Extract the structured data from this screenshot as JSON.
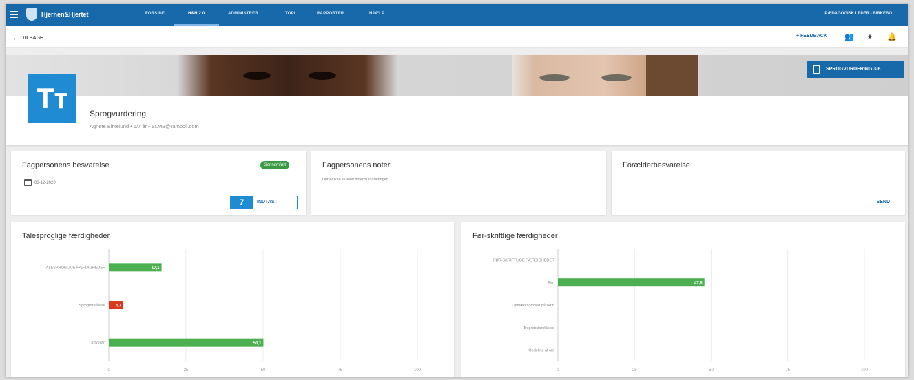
{
  "topnav": {
    "brand": "Hjernen&Hjertet",
    "items": [
      "FORSIDE",
      "H&H 2.0",
      "ADMINISTRER",
      "TOPI",
      "RAPPORTER",
      "HJÆLP"
    ],
    "user": "PÆDAGOGISK LEDER - BIRKEBO"
  },
  "subbar": {
    "back_label": "TILBAGE",
    "feedback_label": "+ FEEDBACK"
  },
  "hero": {
    "logo_text": "Tт",
    "title": "Sprogvurdering",
    "subtitle": "Agnete Birkelund  •  6/7 år  •  SLMB@ramboll.com",
    "button_label": "SPROGVURDERING 3-6"
  },
  "cards": {
    "fagperson": {
      "title": "Fagpersonens besvarelse",
      "badge": "Gennemført",
      "date": "03-12-2020",
      "count": "7",
      "button_label": "INDTAST"
    },
    "noter": {
      "title": "Fagpersonens noter",
      "note": "Der er ikke skrevet noter til vurderingen"
    },
    "foraelder": {
      "title": "Forælderbesvarelse",
      "send_label": "SEND"
    }
  },
  "colors": {
    "primary": "#1769aa",
    "accent": "#1e8bd3",
    "bar_green": "#4caf50",
    "bar_red": "#d9391c",
    "badge_green": "#3b9b45"
  },
  "chart_data": [
    {
      "type": "bar",
      "orientation": "horizontal",
      "title": "Talesproglige færdigheder",
      "categories": [
        "TALESPROGLIGE FÆRDIGHEDER",
        "Sprogforståelse",
        "Ordforråd"
      ],
      "values": [
        17.1,
        4.7,
        50.1
      ],
      "value_labels": [
        "17,1",
        "4,7",
        "50,1"
      ],
      "bar_colors": [
        "#4caf50",
        "#d9391c",
        "#4caf50"
      ],
      "xlim": [
        0,
        100
      ],
      "xticks": [
        "0",
        "25",
        "50",
        "75",
        "100"
      ],
      "grid": true
    },
    {
      "type": "bar",
      "orientation": "horizontal",
      "title": "Før-skriftlige færdigheder",
      "categories": [
        "FØR-SKRIFTLIGE FÆRDIGHEDER",
        "Rim",
        "Opmærksomhed på skrift",
        "Begrebsforståelse",
        "Opdeling af ord"
      ],
      "values": [
        null,
        47.8,
        null,
        null,
        null
      ],
      "value_labels": [
        "",
        "47,8",
        "",
        "",
        ""
      ],
      "bar_colors": [
        "#4caf50",
        "#4caf50",
        "#4caf50",
        "#4caf50",
        "#4caf50"
      ],
      "xlim": [
        0,
        100
      ],
      "xticks": [
        "0",
        "25",
        "50",
        "75",
        "100"
      ],
      "grid": true
    }
  ]
}
